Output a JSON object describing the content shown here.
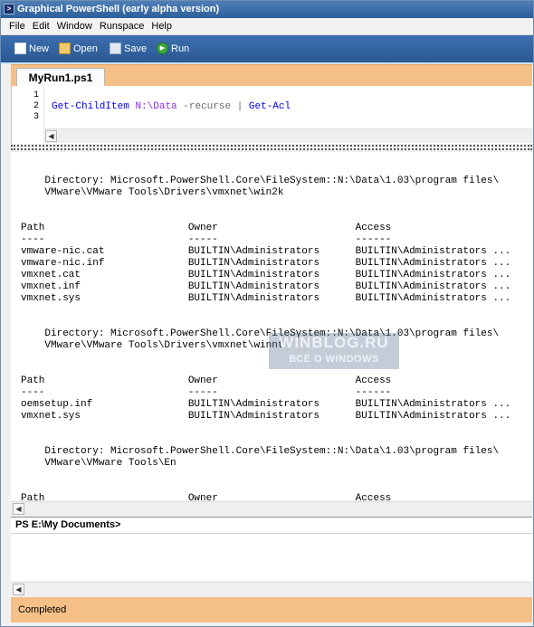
{
  "window": {
    "title": "Graphical PowerShell (early alpha version)"
  },
  "menu": [
    "File",
    "Edit",
    "Window",
    "Runspace",
    "Help"
  ],
  "toolbar": {
    "new_label": "New",
    "open_label": "Open",
    "save_label": "Save",
    "run_label": "Run"
  },
  "tabs": [
    {
      "label": "MyRun1.ps1"
    }
  ],
  "editor": {
    "line_numbers": [
      "1",
      "2",
      "3"
    ],
    "code": {
      "cmd1": "Get-ChildItem",
      "path": "N:\\Data",
      "param": "-recurse",
      "pipe": "|",
      "cmd2": "Get-Acl"
    }
  },
  "output": {
    "lines": [
      "    Directory: Microsoft.PowerShell.Core\\FileSystem::N:\\Data\\1.03\\program files\\",
      "    VMware\\VMware Tools\\Drivers\\vmxnet\\win2k",
      "",
      "",
      "Path                        Owner                       Access",
      "----                        -----                       ------",
      "vmware-nic.cat              BUILTIN\\Administrators      BUILTIN\\Administrators ...",
      "vmware-nic.inf              BUILTIN\\Administrators      BUILTIN\\Administrators ...",
      "vmxnet.cat                  BUILTIN\\Administrators      BUILTIN\\Administrators ...",
      "vmxnet.inf                  BUILTIN\\Administrators      BUILTIN\\Administrators ...",
      "vmxnet.sys                  BUILTIN\\Administrators      BUILTIN\\Administrators ...",
      "",
      "",
      "    Directory: Microsoft.PowerShell.Core\\FileSystem::N:\\Data\\1.03\\program files\\",
      "    VMware\\VMware Tools\\Drivers\\vmxnet\\winnt",
      "",
      "",
      "Path                        Owner                       Access",
      "----                        -----                       ------",
      "oemsetup.inf                BUILTIN\\Administrators      BUILTIN\\Administrators ...",
      "vmxnet.sys                  BUILTIN\\Administrators      BUILTIN\\Administrators ...",
      "",
      "",
      "    Directory: Microsoft.PowerShell.Core\\FileSystem::N:\\Data\\1.03\\program files\\",
      "    VMware\\VMware Tools\\En",
      "",
      "",
      "Path                        Owner                       Access"
    ]
  },
  "watermark": {
    "line1": "WINBLOG.RU",
    "line2": "ВСЁ О WINDOWS"
  },
  "prompt": {
    "text": "PS E:\\My Documents>"
  },
  "status": {
    "text": "Completed"
  },
  "icons": {
    "new": "new-document-icon",
    "open": "open-folder-icon",
    "save": "save-disk-icon",
    "run": "run-play-icon",
    "scroll_left": "arrow-left-icon"
  }
}
